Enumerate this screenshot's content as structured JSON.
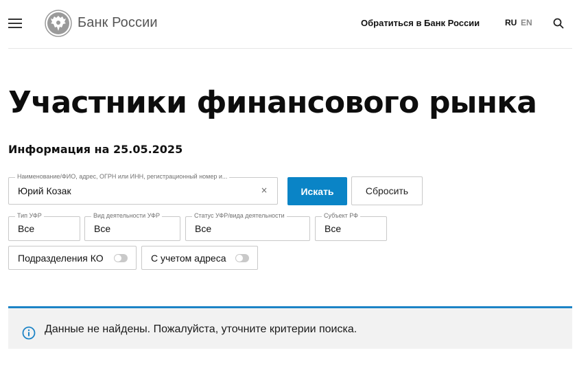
{
  "header": {
    "brand": "Банк России",
    "contact_link": "Обратиться в Банк России",
    "lang_ru": "RU",
    "lang_en": "EN"
  },
  "main": {
    "title": "Участники финансового рынка",
    "info_date": "Информация на 25.05.2025"
  },
  "search": {
    "label": "Наименование/ФИО, адрес, ОГРН или ИНН, регистрационный номер и...",
    "value": "Юрий Козак",
    "clear": "×",
    "search_button": "Искать",
    "reset_button": "Сбросить"
  },
  "filters": [
    {
      "label": "Тип УФР",
      "value": "Все"
    },
    {
      "label": "Вид деятельности УФР",
      "value": "Все"
    },
    {
      "label": "Статус УФР/вида деятельности",
      "value": "Все"
    },
    {
      "label": "Субъект РФ",
      "value": "Все"
    }
  ],
  "toggles": [
    {
      "label": "Подразделения КО",
      "checked": false
    },
    {
      "label": "С учетом адреса",
      "checked": false
    }
  ],
  "notice": {
    "message": "Данные не найдены. Пожалуйста, уточните критерии поиска."
  },
  "colors": {
    "accent": "#0a84c6",
    "notice_border": "#1c83c6",
    "notice_bg": "#f2f2f2"
  },
  "icons": {
    "menu": "hamburger-icon",
    "logo": "double-eagle-emblem-icon",
    "search": "search-icon",
    "info": "info-circle-icon"
  }
}
